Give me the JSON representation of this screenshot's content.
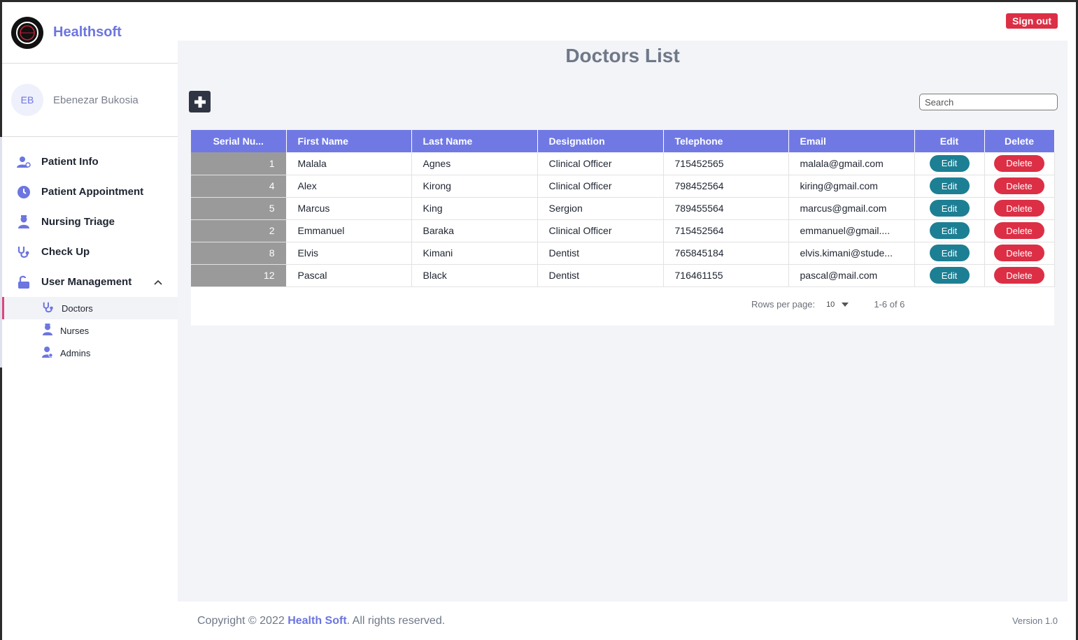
{
  "app": {
    "name": "Healthsoft",
    "sign_out_label": "Sign out"
  },
  "user": {
    "initials": "EB",
    "name": "Ebenezar Bukosia"
  },
  "sidebar": {
    "items": [
      {
        "label": "Patient Info",
        "icon": "user-icon"
      },
      {
        "label": "Patient Appointment",
        "icon": "clock-icon"
      },
      {
        "label": "Nursing Triage",
        "icon": "nurse-icon"
      },
      {
        "label": "Check Up",
        "icon": "stethoscope-icon"
      },
      {
        "label": "User Management",
        "icon": "lock-open-icon"
      }
    ],
    "subitems": [
      {
        "label": "Doctors",
        "icon": "stethoscope-icon",
        "active": true
      },
      {
        "label": "Nurses",
        "icon": "nurse-icon"
      },
      {
        "label": "Admins",
        "icon": "admin-icon"
      }
    ]
  },
  "main": {
    "title": "Doctors List",
    "search_placeholder": "Search",
    "columns": [
      "Serial Nu...",
      "First Name",
      "Last Name",
      "Designation",
      "Telephone",
      "Email",
      "Edit",
      "Delete"
    ],
    "rows": [
      {
        "serial": "1",
        "first": "Malala",
        "last": "Agnes",
        "designation": "Clinical Officer",
        "telephone": "715452565",
        "email": "malala@gmail.com",
        "edit": "Edit",
        "delete": "Delete"
      },
      {
        "serial": "4",
        "first": "Alex",
        "last": "Kirong",
        "designation": "Clinical Officer",
        "telephone": "798452564",
        "email": "kiring@gmail.com",
        "edit": "Edit",
        "delete": "Delete"
      },
      {
        "serial": "5",
        "first": "Marcus",
        "last": "King",
        "designation": "Sergion",
        "telephone": "789455564",
        "email": "marcus@gmail.com",
        "edit": "Edit",
        "delete": "Delete"
      },
      {
        "serial": "2",
        "first": "Emmanuel",
        "last": "Baraka",
        "designation": "Clinical Officer",
        "telephone": "715452564",
        "email": "emmanuel@gmail....",
        "edit": "Edit",
        "delete": "Delete"
      },
      {
        "serial": "8",
        "first": "Elvis",
        "last": "Kimani",
        "designation": "Dentist",
        "telephone": "765845184",
        "email": "elvis.kimani@stude...",
        "edit": "Edit",
        "delete": "Delete"
      },
      {
        "serial": "12",
        "first": "Pascal",
        "last": "Black",
        "designation": "Dentist",
        "telephone": "716461155",
        "email": "pascal@mail.com",
        "edit": "Edit",
        "delete": "Delete"
      }
    ],
    "pagination": {
      "rows_per_page_label": "Rows per page:",
      "rows_per_page": "10",
      "range": "1-6 of 6"
    }
  },
  "footer": {
    "copyright_prefix": "Copyright © 2022 ",
    "brand": "Health Soft",
    "copyright_suffix": ". All rights reserved.",
    "version": "Version 1.0"
  },
  "colors": {
    "accent": "#6c75e0",
    "header": "#7079e3",
    "edit": "#1d7f93",
    "danger": "#dc2f45"
  }
}
